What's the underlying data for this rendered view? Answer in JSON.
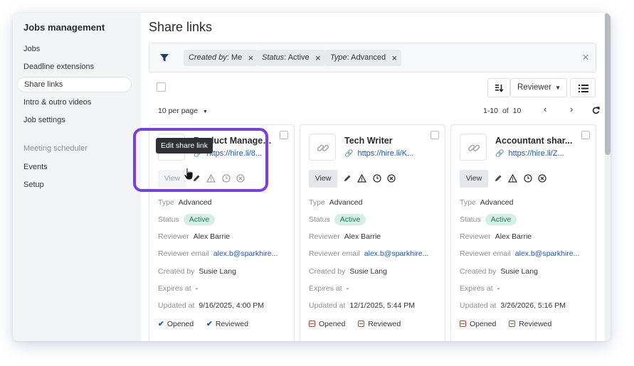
{
  "sidebar": {
    "title": "Jobs management",
    "items": [
      {
        "label": "Jobs"
      },
      {
        "label": "Deadline extensions"
      },
      {
        "label": "Share links"
      },
      {
        "label": "Intro & outro videos"
      },
      {
        "label": "Job settings"
      }
    ],
    "section_label": "Meeting scheduler",
    "section_items": [
      {
        "label": "Events"
      },
      {
        "label": "Setup"
      }
    ]
  },
  "page": {
    "title": "Share links"
  },
  "filters": [
    {
      "key": "Created by",
      "value": "Me"
    },
    {
      "key": "Status",
      "value": "Active"
    },
    {
      "key": "Type",
      "value": "Advanced"
    }
  ],
  "toolbar": {
    "sort_select": "Reviewer",
    "per_page": "10 per page"
  },
  "pagination": {
    "range": "1-10",
    "of": "of",
    "total": "10"
  },
  "field_labels": {
    "type": "Type",
    "status": "Status",
    "reviewer": "Reviewer",
    "reviewer_email": "Reviewer email",
    "created_by": "Created by",
    "expires_at": "Expires at",
    "updated_at": "Updated at"
  },
  "view_label": "View",
  "flag_labels": {
    "opened": "Opened",
    "reviewed": "Reviewed"
  },
  "cards": [
    {
      "title": "Product Managem...",
      "url": "https://hire.li/8...",
      "type": "Advanced",
      "status": "Active",
      "reviewer": "Alex Barrie",
      "reviewer_email": "alex.b@sparkhire...",
      "created_by": "Susie Lang",
      "expires_at": "-",
      "updated_at": "9/16/2025, 4:00 PM",
      "opened": true,
      "reviewed": true
    },
    {
      "title": "Tech Writer",
      "url": "https://hire.li/K...",
      "type": "Advanced",
      "status": "Active",
      "reviewer": "Alex Barrie",
      "reviewer_email": "alex.b@sparkhire...",
      "created_by": "Susie Lang",
      "expires_at": "-",
      "updated_at": "12/1/2025, 5:44 PM",
      "opened": false,
      "reviewed": false
    },
    {
      "title": "Accountant shar...",
      "url": "https://hire.li/Z...",
      "type": "Advanced",
      "status": "Active",
      "reviewer": "Alex Barrie",
      "reviewer_email": "alex.b@sparkhire...",
      "created_by": "Susie Lang",
      "expires_at": "-",
      "updated_at": "3/26/2026, 5:16 PM",
      "opened": false,
      "reviewed": false
    }
  ],
  "tooltip": {
    "text": "Edit share link"
  },
  "colors": {
    "accent_link": "#1d55b8",
    "active_badge_bg": "#d6efe6",
    "active_badge_text": "#1c7a55",
    "highlight": "#7a3fe0",
    "tooltip_bg": "#2f3033",
    "negative_flag": "#dd3333"
  }
}
